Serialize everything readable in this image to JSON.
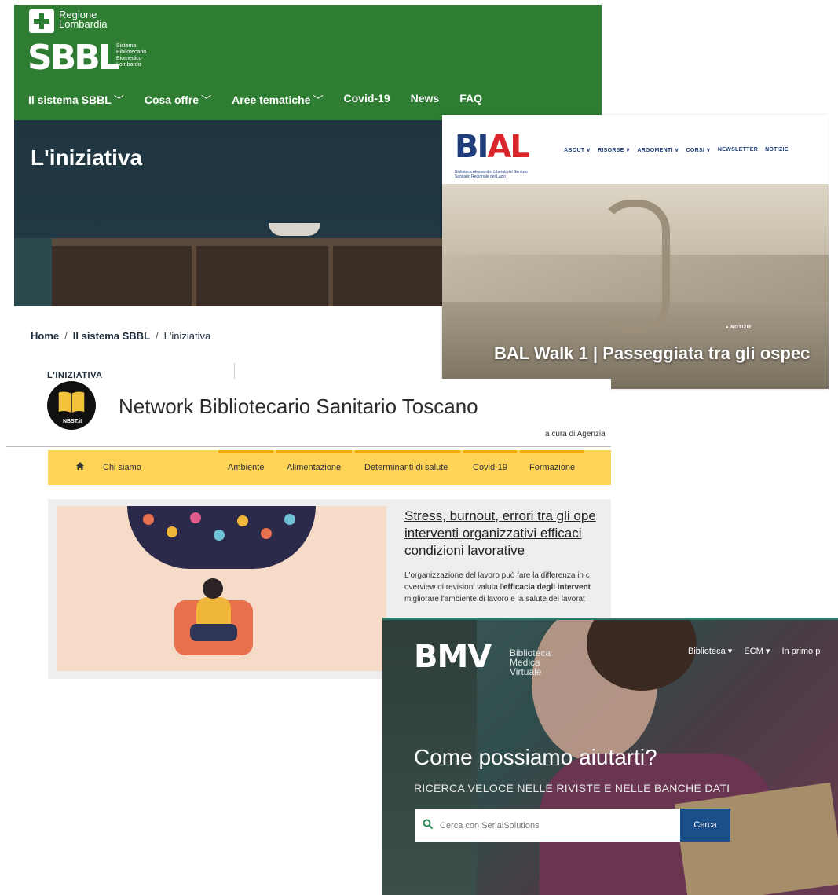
{
  "sbbl": {
    "region": [
      "Regione",
      "Lombardia"
    ],
    "logo": "SBBL",
    "logo_sub": [
      "Sistema",
      "Bibliotecario",
      "Biomedico",
      "Lombardo"
    ],
    "nav": [
      {
        "label": "Il sistema SBBL",
        "has_dropdown": true
      },
      {
        "label": "Cosa offre",
        "has_dropdown": true
      },
      {
        "label": "Aree tematiche",
        "has_dropdown": true
      },
      {
        "label": "Covid-19",
        "has_dropdown": false
      },
      {
        "label": "News",
        "has_dropdown": false
      },
      {
        "label": "FAQ",
        "has_dropdown": false
      }
    ],
    "chevron": "﹀",
    "hero_title": "L'iniziativa",
    "breadcrumb": [
      "Home",
      "Il sistema SBBL",
      "L'iniziativa"
    ],
    "breadcrumb_sep": "/",
    "section_label": "L'INIZIATIVA",
    "color_green": "#2e7d32"
  },
  "bal": {
    "logo_letters": [
      "B",
      "I",
      "A",
      "L"
    ],
    "logo_sub": "Biblioteca Alessandro Liberati del Servizio Sanitario Regionale del Lazio",
    "nav": [
      "ABOUT ∨",
      "RISORSE ∨",
      "ARGOMENTI ∨",
      "CORSI ∨",
      "NEWSLETTER",
      "NOTIZIE"
    ],
    "tag": "● NOTIZIE",
    "headline": "BAL Walk 1 | Passeggiata tra gli ospec"
  },
  "nbst": {
    "logo_tag": "NBST.it",
    "title": "Network Bibliotecario Sanitario Toscano",
    "a_cura": "a cura di Agenzia",
    "menu": [
      "Chi siamo",
      "Ambiente",
      "Alimentazione",
      "Determinanti di salute",
      "Covid-19",
      "Formazione"
    ],
    "article_title": [
      "Stress, burnout, errori tra gli ope",
      "interventi organizzativi efficaci",
      "condizioni lavorative"
    ],
    "article_body": [
      "L'organizzazione del lavoro può fare la differenza in c",
      "overview di revisioni valuta l'",
      "efficacia degli intervent",
      "migliorare l'ambiente di lavoro e la salute dei lavorat"
    ],
    "color_menu": "#fdd458"
  },
  "bmv": {
    "logo": "BMV",
    "logo_sub": [
      "Biblioteca",
      "Medica",
      "Virtuale"
    ],
    "nav": [
      "Biblioteca ▾",
      "ECM ▾",
      "In primo p"
    ],
    "headline": "Come possiamo aiutarti?",
    "subline": "RICERCA VELOCE NELLE RIVISTE E NELLE BANCHE DATI",
    "search_placeholder": "Cerca con SerialSolutions",
    "search_button": "Cerca",
    "color_button": "#1b4f8c"
  }
}
